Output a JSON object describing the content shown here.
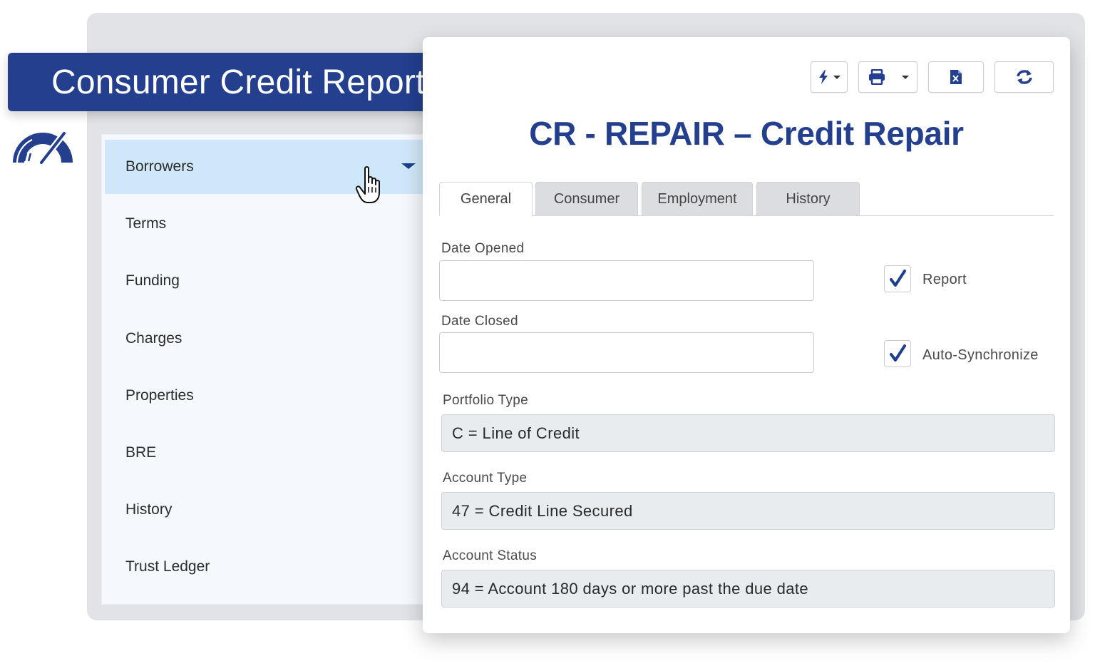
{
  "banner": {
    "title": "Consumer Credit Reporting"
  },
  "logo": {
    "icon": "speedometer-gauge-icon",
    "color": "#233f8e"
  },
  "sidebar": {
    "items": [
      {
        "label": "Borrowers",
        "active": true
      },
      {
        "label": "Terms"
      },
      {
        "label": "Funding"
      },
      {
        "label": "Charges"
      },
      {
        "label": "Properties"
      },
      {
        "label": "BRE"
      },
      {
        "label": "History"
      },
      {
        "label": "Trust Ledger"
      }
    ]
  },
  "toolbar": {
    "buttons": [
      {
        "icon": "lightning-bolt-icon",
        "has_dropdown": true
      },
      {
        "icon": "printer-icon",
        "has_dropdown": true
      },
      {
        "icon": "excel-export-icon",
        "has_dropdown": false
      },
      {
        "icon": "refresh-icon",
        "has_dropdown": false
      }
    ]
  },
  "record": {
    "title": "CR - REPAIR – Credit Repair"
  },
  "tabs": [
    {
      "label": "General",
      "active": true
    },
    {
      "label": "Consumer"
    },
    {
      "label": "Employment"
    },
    {
      "label": "History"
    }
  ],
  "form": {
    "date_opened": {
      "label": "Date Opened",
      "value": ""
    },
    "date_closed": {
      "label": "Date Closed",
      "value": ""
    },
    "report": {
      "label": "Report",
      "checked": true
    },
    "auto_sync": {
      "label": "Auto-Synchronize",
      "checked": true
    },
    "portfolio_type": {
      "label": "Portfolio Type",
      "value": "C = Line of Credit"
    },
    "account_type": {
      "label": "Account Type",
      "value": "47 = Credit Line Secured"
    },
    "account_status": {
      "label": "Account Status",
      "value": "94 = Account 180 days or more past the due date"
    }
  },
  "colors": {
    "brand": "#233f8e",
    "active_row": "#cfe8f9",
    "check": "#1d3f8c"
  }
}
